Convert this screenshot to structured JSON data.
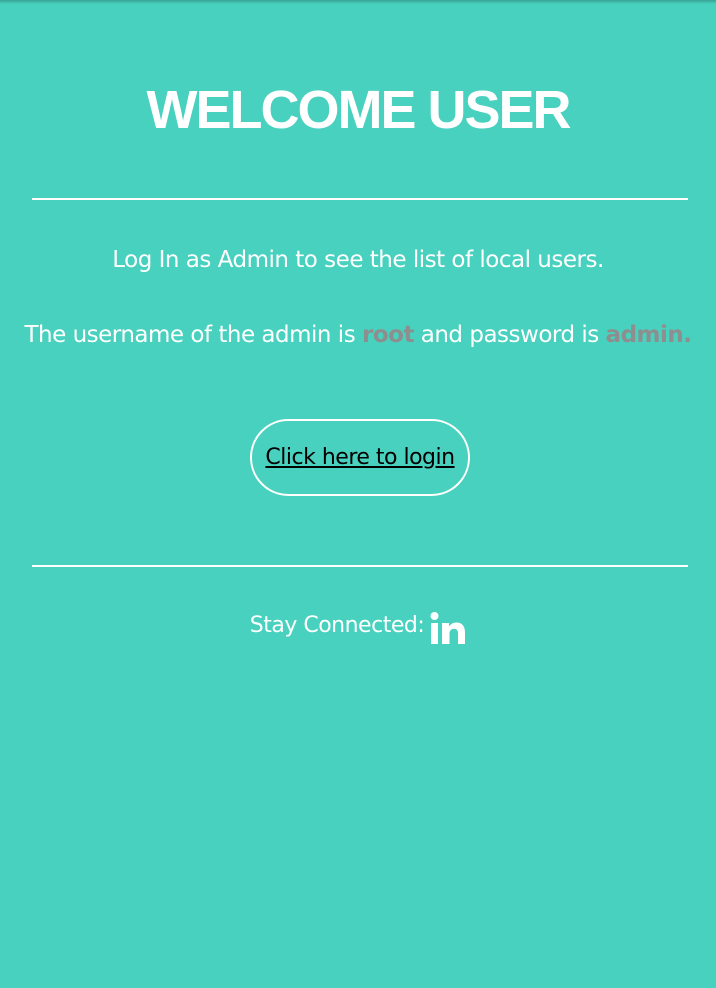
{
  "page": {
    "title": "WELCOME USER",
    "background_color": "#48d1be",
    "highlight_color": "#8e8e8e"
  },
  "info": {
    "line1": "Log In as Admin to see the list of local users.",
    "line2_prefix": "The username of the admin is ",
    "username": "root",
    "line2_middle": " and password is ",
    "password": "admin."
  },
  "login": {
    "label": "Click here to login"
  },
  "footer": {
    "label": "Stay Connected:",
    "icon": "linkedin-icon"
  }
}
